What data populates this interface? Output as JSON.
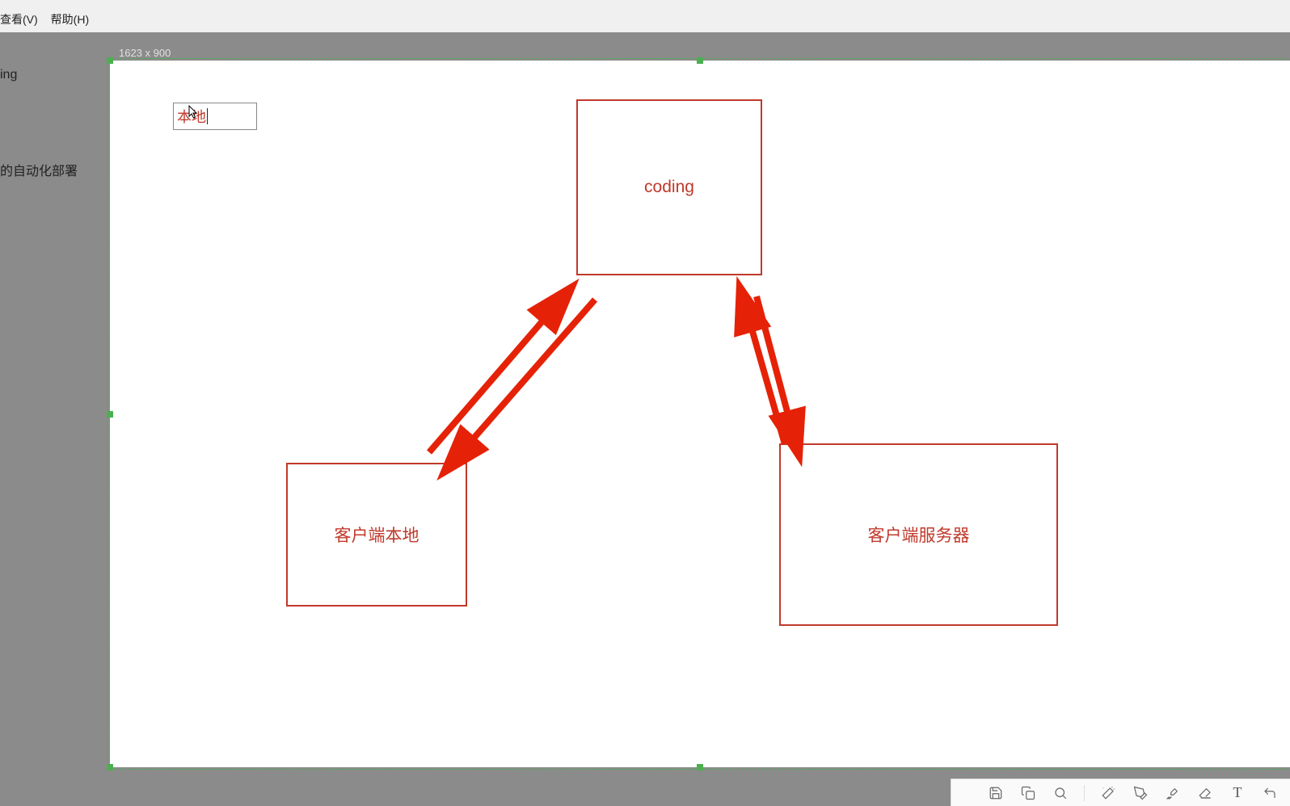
{
  "menu": {
    "view": "查看(V)",
    "help": "帮助(H)"
  },
  "sidebar": {
    "title": "ing",
    "item1": "的自动化部署"
  },
  "canvas": {
    "dimensions": "1623 x 900",
    "editing_text": "本地",
    "boxes": {
      "top": "coding",
      "left": "客户端本地",
      "right": "客户端服务器"
    }
  },
  "toolbar": {
    "save": "save-icon",
    "copy": "copy-icon",
    "search": "search-icon",
    "magic": "magic-wand-icon",
    "pen": "pen-icon",
    "highlighter": "highlighter-icon",
    "eraser": "eraser-icon",
    "text": "T",
    "undo": "undo-icon"
  }
}
